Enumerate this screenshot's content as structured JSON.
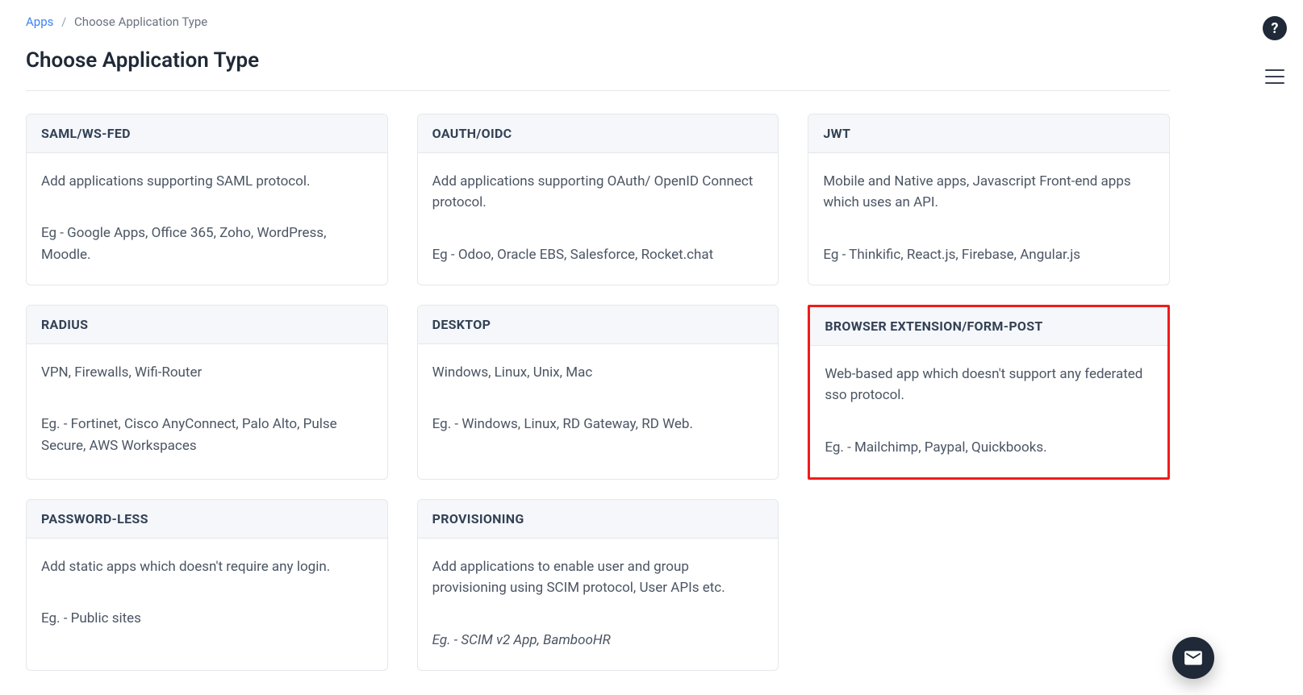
{
  "breadcrumb": {
    "root": "Apps",
    "current": "Choose Application Type"
  },
  "page_title": "Choose Application Type",
  "cards": [
    {
      "title": "SAML/WS-FED",
      "desc": "Add applications supporting SAML protocol.",
      "eg": "Eg - Google Apps, Office 365, Zoho, WordPress, Moodle.",
      "highlighted": false
    },
    {
      "title": "OAUTH/OIDC",
      "desc": "Add applications supporting OAuth/ OpenID Connect protocol.",
      "eg": "Eg - Odoo, Oracle EBS, Salesforce, Rocket.chat",
      "highlighted": false
    },
    {
      "title": "JWT",
      "desc": "Mobile and Native apps, Javascript Front-end apps which uses an API.",
      "eg": "Eg - Thinkific, React.js, Firebase, Angular.js",
      "highlighted": false
    },
    {
      "title": "RADIUS",
      "desc": "VPN, Firewalls, Wifi-Router",
      "eg": "Eg. - Fortinet, Cisco AnyConnect, Palo Alto, Pulse Secure, AWS Workspaces",
      "highlighted": false
    },
    {
      "title": "DESKTOP",
      "desc": "Windows, Linux, Unix, Mac",
      "eg": "Eg. - Windows, Linux, RD Gateway, RD Web.",
      "highlighted": false
    },
    {
      "title": "BROWSER EXTENSION/FORM-POST",
      "desc": "Web-based app which doesn't support any federated sso protocol.",
      "eg": "Eg. - Mailchimp, Paypal, Quickbooks.",
      "highlighted": true
    },
    {
      "title": "PASSWORD-LESS",
      "desc": "Add static apps which doesn't require any login.",
      "eg": "Eg. - Public sites",
      "highlighted": false
    },
    {
      "title": "PROVISIONING",
      "desc": "Add applications to enable user and group provisioning using SCIM protocol, User APIs etc.",
      "eg": "Eg. - SCIM v2 App, BambooHR",
      "eg_italic": true,
      "highlighted": false
    }
  ],
  "rail": {
    "help_label": "?",
    "menu_label": "Menu"
  }
}
